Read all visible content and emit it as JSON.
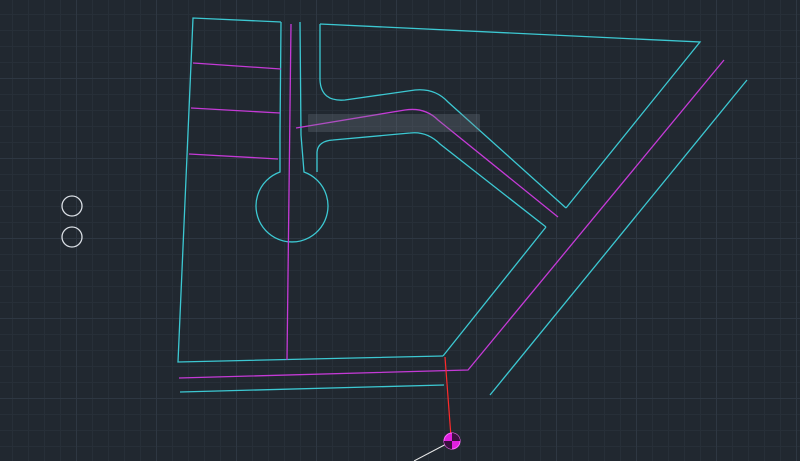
{
  "viewport": {
    "background": "#212830",
    "grid_major_color": "#2e3742",
    "grid_minor_color": "#272f38"
  },
  "colors": {
    "boundary": "#3cc8d2",
    "centerline": "#c43ad6",
    "dimension": "#ff2a2a",
    "circle": "#d8dde3",
    "cursor": "#e020e0",
    "crosshair": "#e8e8e8"
  },
  "objects": {
    "parcel_boundary": "polyline",
    "cul_de_sac_road": "polyline",
    "diagonal_road": "polyline",
    "bottom_road": "polyline",
    "centerlines": "polyline",
    "lot_lines": "line",
    "navigation_circles": "circle",
    "cursor_marker": "snap-marker-icon"
  }
}
